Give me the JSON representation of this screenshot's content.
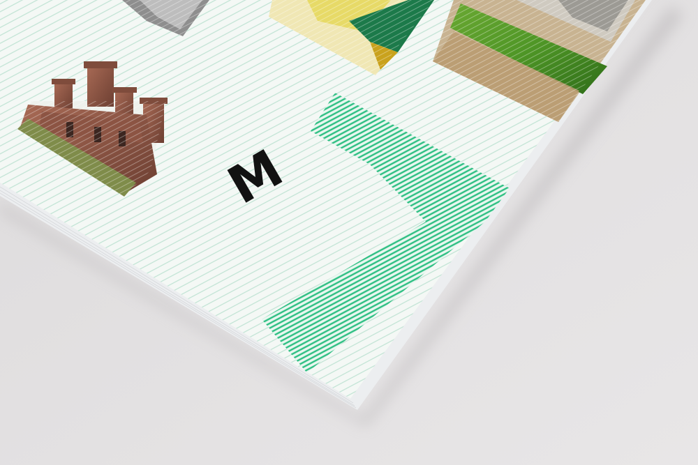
{
  "cover": {
    "letter": "M"
  },
  "colors": {
    "background": "#e4e2e3",
    "paper": "#f4f8f5",
    "stripe": "#bfe3d3",
    "accent_green": "#2dbf82",
    "letter": "#121212"
  },
  "icons": {
    "arrow": "chevron-arrow-graphic",
    "castle": "castle-ruin-photo",
    "grass": "grass-field-photo",
    "yellow": "yellow-flower-photo",
    "bw": "black-white-photo"
  }
}
